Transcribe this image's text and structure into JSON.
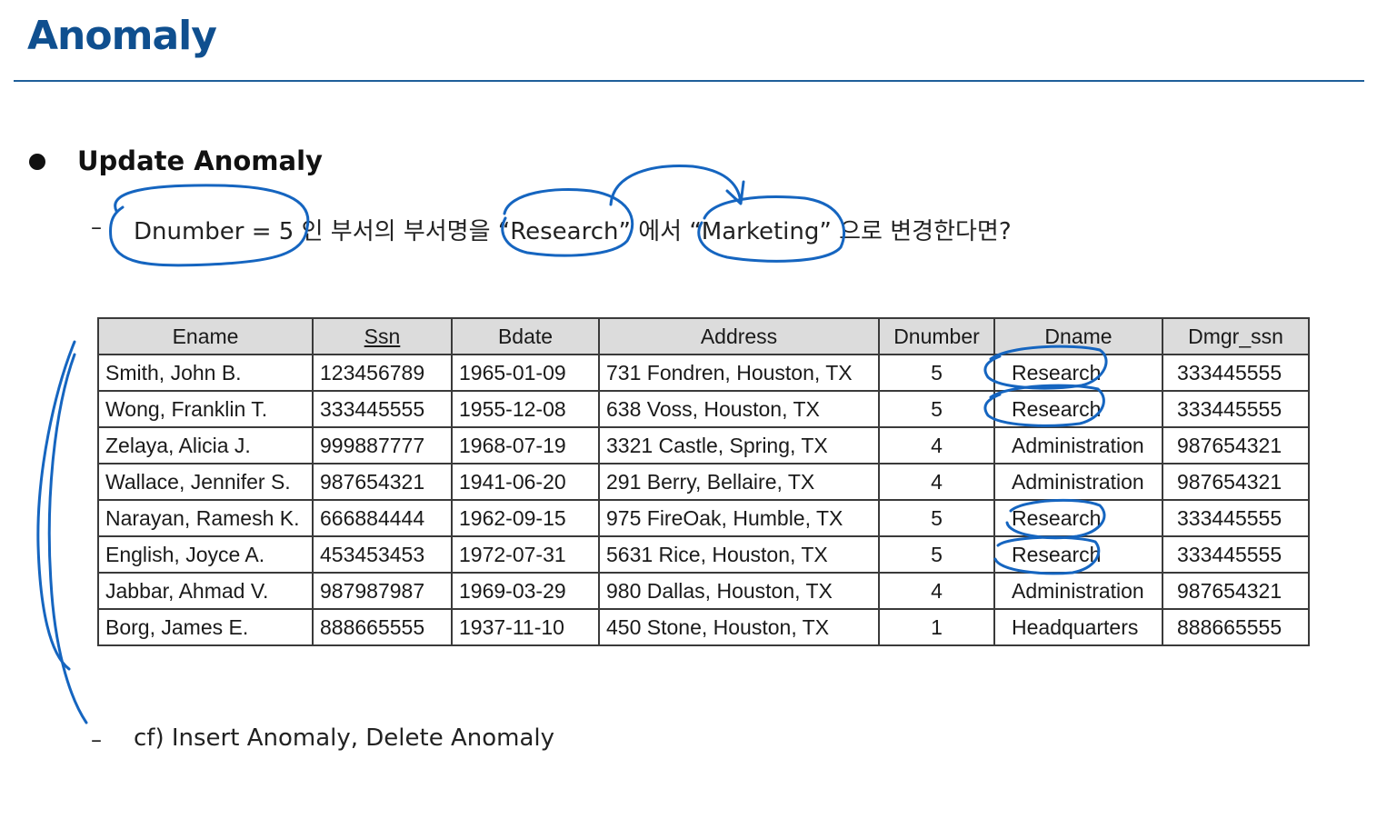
{
  "page": {
    "title": "Anomaly"
  },
  "bullet": {
    "heading": "Update Anomaly"
  },
  "items": [
    {
      "dash": "–",
      "text": "Dnumber = 5 인 부서의 부서명을  “Research” 에서 “Marketing” 으로 변경한다면?"
    },
    {
      "dash": "–",
      "text": "cf) Insert Anomaly, Delete Anomaly"
    }
  ],
  "table": {
    "columns": [
      "Ename",
      "Ssn",
      "Bdate",
      "Address",
      "Dnumber",
      "Dname",
      "Dmgr_ssn"
    ],
    "rows": [
      [
        "Smith, John B.",
        "123456789",
        "1965-01-09",
        "731 Fondren, Houston, TX",
        "5",
        "Research",
        "333445555"
      ],
      [
        "Wong, Franklin T.",
        "333445555",
        "1955-12-08",
        "638 Voss, Houston, TX",
        "5",
        "Research",
        "333445555"
      ],
      [
        "Zelaya, Alicia J.",
        "999887777",
        "1968-07-19",
        "3321 Castle, Spring, TX",
        "4",
        "Administration",
        "987654321"
      ],
      [
        "Wallace, Jennifer S.",
        "987654321",
        "1941-06-20",
        "291 Berry, Bellaire, TX",
        "4",
        "Administration",
        "987654321"
      ],
      [
        "Narayan, Ramesh K.",
        "666884444",
        "1962-09-15",
        "975 FireOak, Humble, TX",
        "5",
        "Research",
        "333445555"
      ],
      [
        "English, Joyce A.",
        "453453453",
        "1972-07-31",
        "5631 Rice, Houston, TX",
        "5",
        "Research",
        "333445555"
      ],
      [
        "Jabbar, Ahmad V.",
        "987987987",
        "1969-03-29",
        "980 Dallas, Houston, TX",
        "4",
        "Administration",
        "987654321"
      ],
      [
        "Borg, James E.",
        "888665555",
        "1937-11-10",
        "450 Stone, Houston, TX",
        "1",
        "Headquarters",
        "888665555"
      ]
    ]
  },
  "colors": {
    "title": "#0f4f8f",
    "rule": "#1f5f9a",
    "annotation_ink": "#1565c0",
    "header_fill": "#dcdcdc"
  }
}
